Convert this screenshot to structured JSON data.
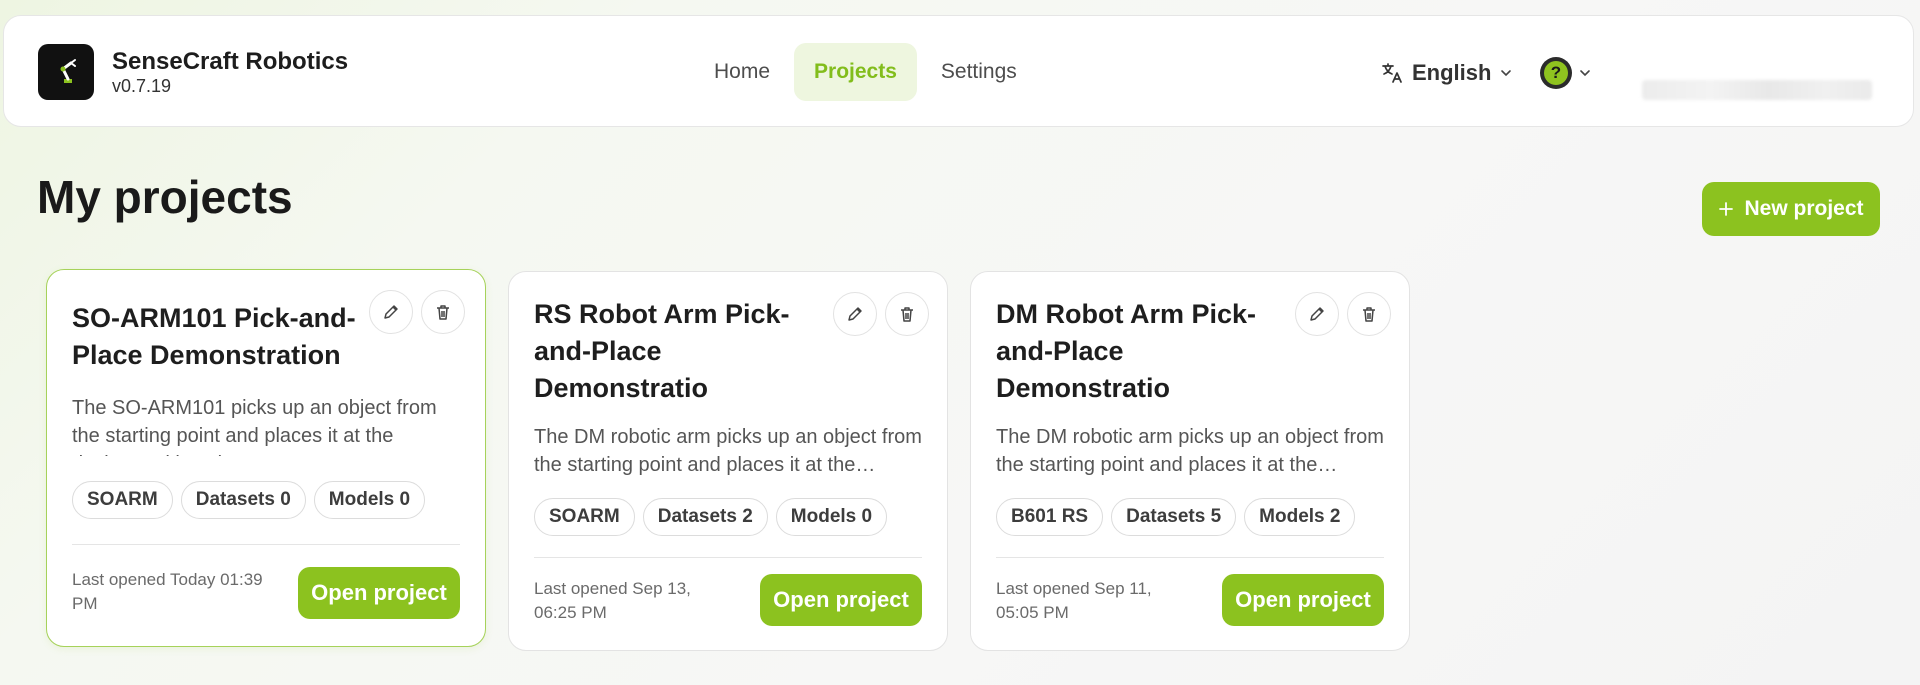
{
  "app": {
    "title": "SenseCraft Robotics",
    "version": "v0.7.19",
    "accent_color": "#8cc21f"
  },
  "nav": {
    "tabs": [
      {
        "label": "Home",
        "active": false
      },
      {
        "label": "Projects",
        "active": true
      },
      {
        "label": "Settings",
        "active": false
      }
    ]
  },
  "header": {
    "language": "English",
    "language_icon": "translate-icon",
    "help_icon": "help-icon"
  },
  "page": {
    "title": "My projects",
    "new_project_label": "New project"
  },
  "projects": [
    {
      "title": "SO-ARM101 Pick-and-Place Demonstration",
      "description": "The SO-ARM101 picks up an object from the starting point and places it at the designated location.",
      "tags": [
        "SOARM",
        "Datasets 0",
        "Models 0"
      ],
      "last_opened": "Last opened Today 01:39 PM",
      "open_label": "Open project"
    },
    {
      "title": "RS Robot Arm Pick-and-Place Demonstratio",
      "description": "The DM robotic arm picks up an object from the starting point and places it at the…",
      "tags": [
        "SOARM",
        "Datasets 2",
        "Models 0"
      ],
      "last_opened": "Last opened Sep 13, 06:25 PM",
      "open_label": "Open project"
    },
    {
      "title": "DM Robot Arm Pick-and-Place Demonstratio",
      "description": "The DM robotic arm picks up an object from the starting point and places it at the…",
      "tags": [
        "B601 RS",
        "Datasets 5",
        "Models 2"
      ],
      "last_opened": "Last opened Sep 11, 05:05 PM",
      "open_label": "Open project"
    }
  ]
}
